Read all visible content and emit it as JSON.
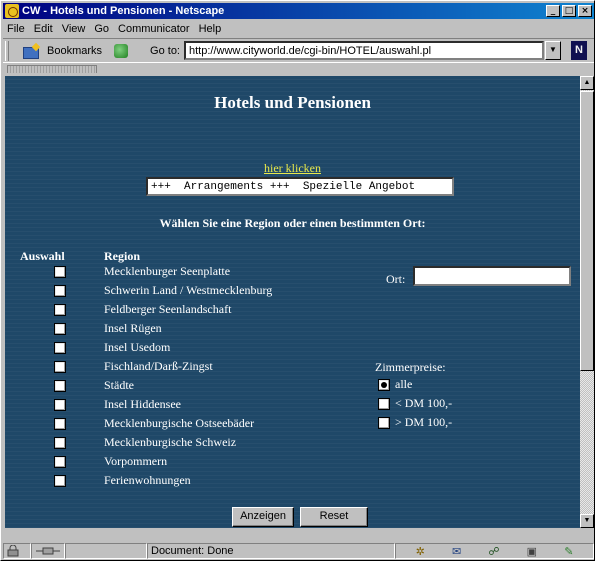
{
  "window": {
    "title": "CW - Hotels und Pensionen - Netscape"
  },
  "menu": [
    "File",
    "Edit",
    "View",
    "Go",
    "Communicator",
    "Help"
  ],
  "toolbar": {
    "bookmarks_label": "Bookmarks",
    "goto_label": "Go to:",
    "url": "http://www.cityworld.de/cgi-bin/HOTEL/auswahl.pl"
  },
  "page": {
    "heading": "Hotels und Pensionen",
    "link_text": "hier klicken",
    "arrangements_select": "+++  Arrangements +++  Spezielle Angebot",
    "instruction": "Wählen Sie eine Region oder einen bestimmten Ort:",
    "col_auswahl": "Auswahl",
    "col_region": "Region",
    "regions": [
      "Mecklenburger Seenplatte",
      "Schwerin Land / Westmecklenburg",
      "Feldberger Seenlandschaft",
      "Insel Rügen",
      "Insel Usedom",
      "Fischland/Darß-Zingst",
      "Städte",
      "Insel Hiddensee",
      "Mecklenburgische Ostseebäder",
      "Mecklenburgische Schweiz",
      "Vorpommern",
      "Ferienwohnungen"
    ],
    "ort_label": "Ort:",
    "ort_value": "",
    "zimmerpreise_label": "Zimmerpreise:",
    "price_options": [
      "alle",
      "< DM 100,-",
      "> DM 100,-"
    ],
    "price_selected": "alle",
    "submit_label": "Anzeigen",
    "reset_label": "Reset"
  },
  "status": {
    "text": "Document: Done"
  }
}
